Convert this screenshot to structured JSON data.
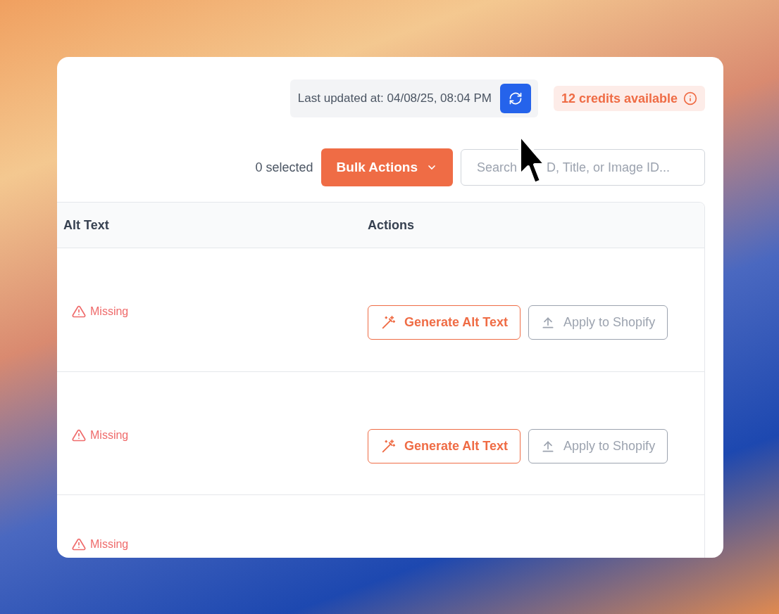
{
  "status_bar": {
    "last_updated": "Last updated at: 04/08/25, 08:04 PM",
    "credits": "12 credits available"
  },
  "toolbar": {
    "selected_count": "0 selected",
    "bulk_actions": "Bulk Actions",
    "search_placeholder_visible": [
      "Search",
      "D, Title, or Image ID..."
    ]
  },
  "table": {
    "columns": [
      "Alt Text",
      "Actions"
    ],
    "rows": [
      {
        "alt_status": "Missing",
        "actions": [
          "Generate Alt Text",
          "Apply to Shopify"
        ]
      },
      {
        "alt_status": "Missing",
        "actions": [
          "Generate Alt Text",
          "Apply to Shopify"
        ]
      },
      {
        "alt_status": "Missing",
        "actions": []
      }
    ]
  }
}
